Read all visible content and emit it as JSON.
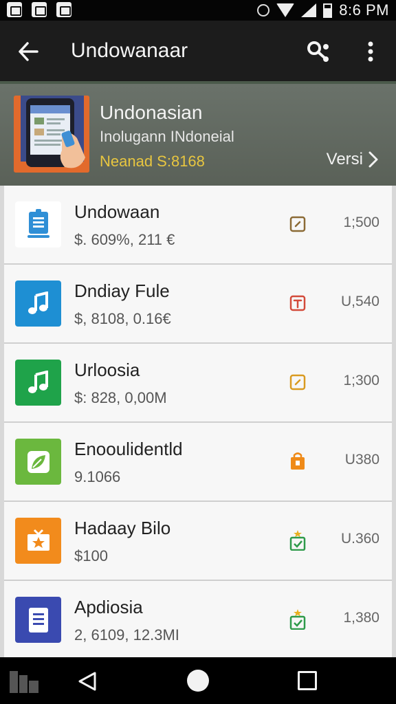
{
  "status_bar": {
    "time": "8:6 PM"
  },
  "app_bar": {
    "title": "Undowanaar"
  },
  "banner": {
    "title": "Undonasian",
    "subtitle": "Inolugann INdoneial",
    "meta": "Neanad  S:8168",
    "link_label": "Versi"
  },
  "items": [
    {
      "title": "Undowaan",
      "subtitle": "$. 609%, 211 €",
      "value": "1;500",
      "icon_color": "#ffffff",
      "icon": "document-icon",
      "status_color": "#8b6a35",
      "status_icon": "square-arrow-icon"
    },
    {
      "title": "Dndiay Fule",
      "subtitle": "$, 8108, 0.16€",
      "value": "U,540",
      "icon_color": "#1e8fd3",
      "icon": "music-note-icon",
      "status_color": "#d34a3a",
      "status_icon": "square-t-icon"
    },
    {
      "title": "Urloosia",
      "subtitle": "$: 828, 0,00M",
      "value": "1;300",
      "icon_color": "#1fa34a",
      "icon": "music-note-icon",
      "status_color": "#d99a20",
      "status_icon": "square-arrow-icon"
    },
    {
      "title": "Enooulidentld",
      "subtitle": "9.1066",
      "value": "U380",
      "icon_color": "#6bb83e",
      "icon": "leaf-icon",
      "status_color": "#ef8a18",
      "status_icon": "lock-box-icon"
    },
    {
      "title": "Hadaay Bilo",
      "subtitle": "$100",
      "value": "U.360",
      "icon_color": "#f28b1c",
      "icon": "star-box-icon",
      "status_color": "#2e9a4a",
      "status_icon": "star-check-icon"
    },
    {
      "title": "Apdiosia",
      "subtitle": "2, 6109, 12.3MI",
      "value": "1,380",
      "icon_color": "#3a4ab0",
      "icon": "document-icon",
      "status_color": "#2e9a4a",
      "status_icon": "star-check-icon"
    }
  ]
}
